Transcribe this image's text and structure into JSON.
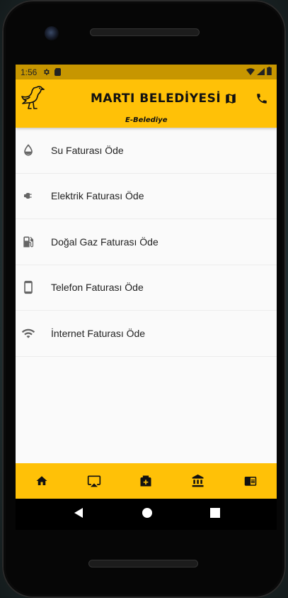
{
  "status": {
    "time": "1:56"
  },
  "app": {
    "title": "MARTI BELEDİYESİ",
    "subtitle": "E-Belediye",
    "actions": [
      {
        "icon": "map-icon"
      },
      {
        "icon": "phone-icon"
      }
    ]
  },
  "services": [
    {
      "label": "Su Faturası Öde",
      "icon": "water-drop-icon"
    },
    {
      "label": "Elektrik Faturası Öde",
      "icon": "power-plug-icon"
    },
    {
      "label": "Doğal Gaz Faturası Öde",
      "icon": "gas-station-icon"
    },
    {
      "label": "Telefon Faturası Öde",
      "icon": "smartphone-icon"
    },
    {
      "label": "İnternet Faturası Öde",
      "icon": "wifi-icon"
    }
  ],
  "bottom_nav": [
    {
      "icon": "home-icon"
    },
    {
      "icon": "airplay-icon"
    },
    {
      "icon": "hospital-icon"
    },
    {
      "icon": "bank-icon"
    },
    {
      "icon": "news-icon"
    }
  ],
  "colors": {
    "primary": "#ffc107",
    "status": "#c79600"
  }
}
